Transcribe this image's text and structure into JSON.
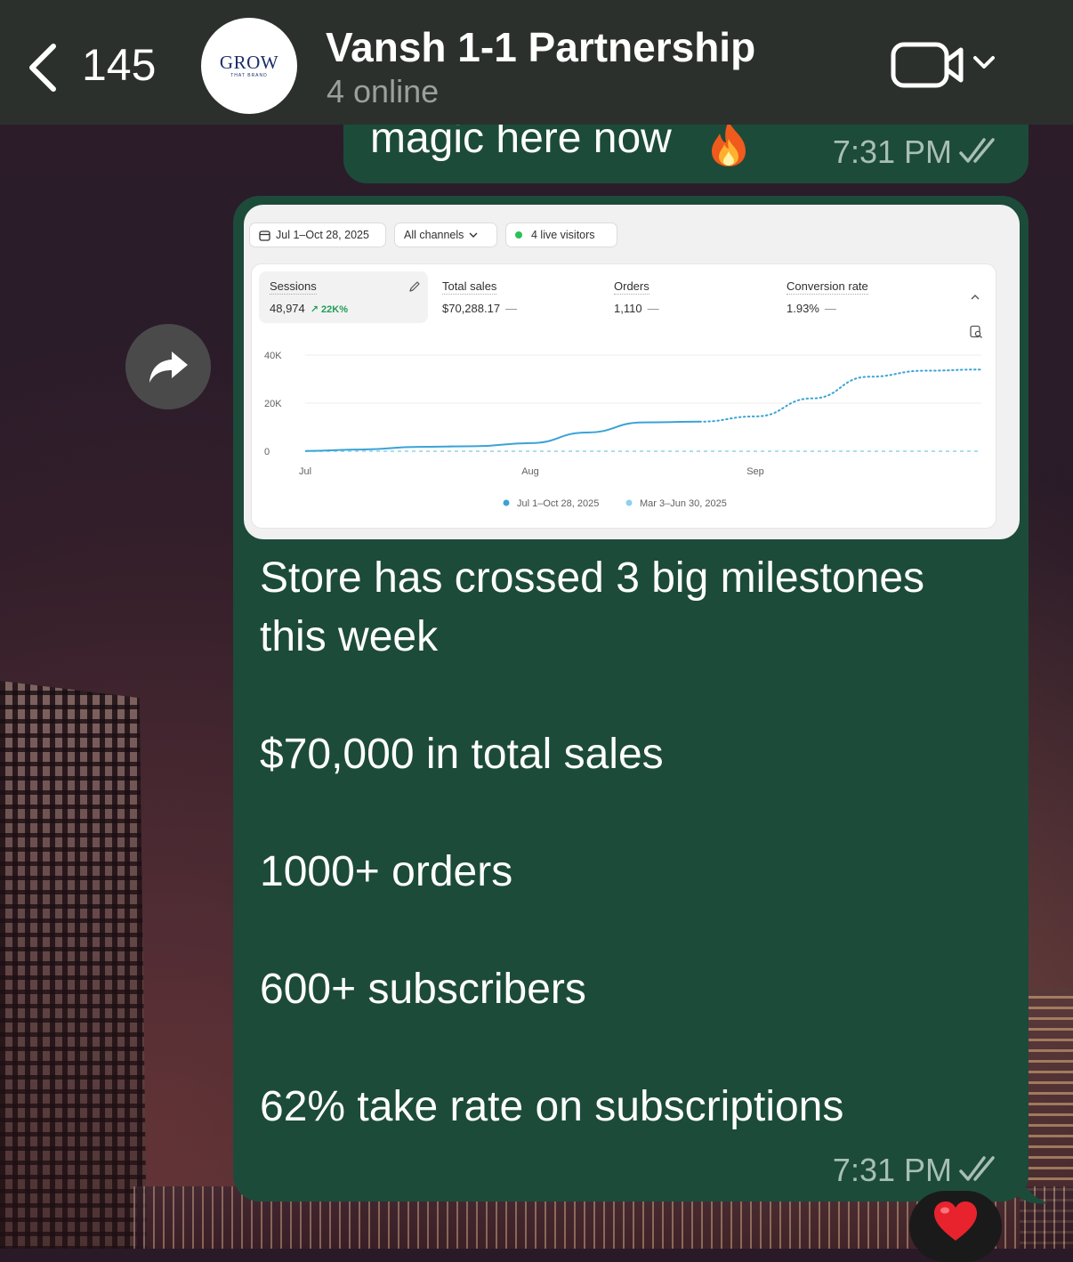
{
  "header": {
    "back_count": "145",
    "avatar_brand": "GROW",
    "avatar_sub": "THAT BRAND",
    "title": "Vansh 1-1 Partnership",
    "status": "4 online"
  },
  "messages": [
    {
      "text": "magic here now",
      "emoji_icon": "fire-emoji",
      "time": "7:31 PM",
      "status_icon": "double-check-icon"
    },
    {
      "lines": [
        "Store has crossed 3 big milestones",
        "this week",
        "$70,000 in total sales",
        "1000+ orders",
        "600+ subscribers",
        "62% take rate on subscriptions"
      ],
      "time": "7:31 PM",
      "status_icon": "double-check-icon",
      "reaction": "heart-emoji"
    }
  ],
  "dashboard": {
    "date_range": "Jul 1–Oct 28, 2025",
    "channel_filter": "All channels",
    "live_visitors": "4 live visitors",
    "metrics": [
      {
        "label": "Sessions",
        "value": "48,974",
        "delta": "22K%"
      },
      {
        "label": "Total sales",
        "value": "$70,288.17",
        "delta": "—"
      },
      {
        "label": "Orders",
        "value": "1,110",
        "delta": "—"
      },
      {
        "label": "Conversion rate",
        "value": "1.93%",
        "delta": "—"
      }
    ]
  },
  "chart_data": {
    "type": "line",
    "title": "Sessions",
    "x": [
      "Jul 1",
      "Jul 15",
      "Aug 1",
      "Aug 8",
      "Aug 15",
      "Aug 22",
      "Sep 1",
      "Sep 10",
      "Sep 20",
      "Oct 1",
      "Oct 10",
      "Oct 20",
      "Oct 28"
    ],
    "x_tick_labels": [
      "Jul",
      "Aug",
      "Sep"
    ],
    "y_tick_labels": [
      "40K",
      "20K",
      "0"
    ],
    "ylim": [
      0,
      40000
    ],
    "legend": {
      "placement": "bottom"
    },
    "series": [
      {
        "name": "Jul 1–Oct 28, 2025",
        "color": "#3aa3d6",
        "style": "solid then dotted",
        "values": [
          100,
          700,
          1800,
          2100,
          3400,
          7800,
          12000,
          12300,
          14500,
          22000,
          31000,
          33500,
          34000
        ],
        "dotted_from_index": 7
      },
      {
        "name": "Mar 3–Jun 30, 2025",
        "color": "#8fd0ee",
        "style": "dashed",
        "values": [
          0,
          0,
          0,
          0,
          0,
          0,
          0,
          0,
          0,
          0,
          0,
          0,
          0
        ]
      }
    ]
  },
  "colors": {
    "header_bg": "#2b302d",
    "bubble_bg": "#1c4b3a",
    "series_current": "#3aa3d6",
    "series_previous": "#8fd0ee"
  }
}
